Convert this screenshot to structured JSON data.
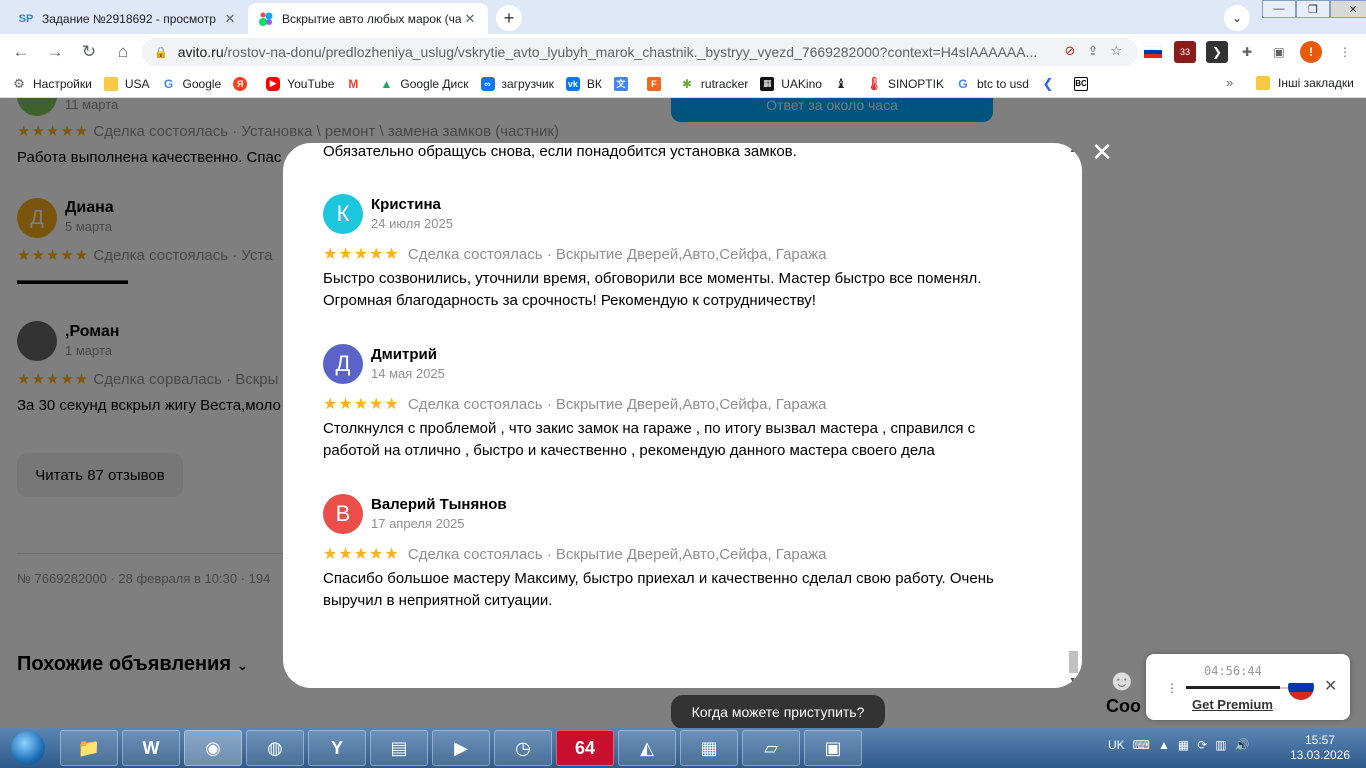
{
  "browser": {
    "tabs": [
      {
        "label": "Задание №2918692 - просмотр",
        "favicon": "SP"
      },
      {
        "label": "Вскрытие авто любых марок (ча",
        "favicon": "avito-dots"
      }
    ],
    "url_host": "avito.ru",
    "url_path": "/rostov-na-donu/predlozheniya_uslug/vskrytie_avto_lyubyh_marok_chastnik._bystryy_vyezd_7669282000?context=H4sIAAAAAA...",
    "extension_badge": "33",
    "bookmarks": [
      {
        "label": "Настройки",
        "icon": "gear-icon"
      },
      {
        "label": "USA",
        "icon": "folder-icon"
      },
      {
        "label": "Google",
        "icon": "google-icon"
      },
      {
        "label": "",
        "icon": "yandex-icon"
      },
      {
        "label": "YouTube",
        "icon": "youtube-icon"
      },
      {
        "label": "",
        "icon": "gmail-icon"
      },
      {
        "label": "Google Диск",
        "icon": "drive-icon"
      },
      {
        "label": "загрузчик",
        "icon": "loader-icon"
      },
      {
        "label": "ВК",
        "icon": "vk-icon"
      },
      {
        "label": "",
        "icon": "translate-icon"
      },
      {
        "label": "",
        "icon": "f-icon"
      },
      {
        "label": "rutracker",
        "icon": "rutracker-icon"
      },
      {
        "label": "UAKino",
        "icon": "uakino-icon"
      },
      {
        "label": "",
        "icon": "chess-icon"
      },
      {
        "label": "SINOPTIK",
        "icon": "thermometer-icon"
      },
      {
        "label": "btc to usd",
        "icon": "google-icon"
      },
      {
        "label": "",
        "icon": "arrow-icon"
      },
      {
        "label": "",
        "icon": "bc-icon"
      }
    ],
    "bookmarks_more": "»",
    "other_bookmarks": "Інші закладки"
  },
  "page_behind": {
    "top_date": "11 марта",
    "review1_meta": "Сделка состоялась · Установка \\ ремонт \\ замена замков (частник)",
    "review1_text": "Работа выполнена качественно. Спас",
    "review2_initial": "Д",
    "review2_name": "Диана",
    "review2_date": "5 марта",
    "review2_meta": "Сделка состоялась · Уста",
    "review2_text": "▬▬▬▬▬▬▬▬▬▬",
    "review3_name": ",Роман",
    "review3_date": "1 марта",
    "review3_meta": "Сделка сорвалась · Вскры",
    "review3_text": "За 30 секунд вскрыл жигу Веста,моло",
    "read_reviews_button": "Читать 87 отзывов",
    "listing_meta": "№ 7669282000 · 28 февраля в 10:30 · 194",
    "similar_heading": "Похожие объявления",
    "blue_button": "Ответ за около часа",
    "bottom_peek": "Соо"
  },
  "modal": {
    "top_text": "Обязательно обращусь снова, если понадобится установка замков.",
    "stars": "★★★★★",
    "reviews": [
      {
        "initial": "К",
        "avatar_color": "#1cc6dd",
        "name": "Кристина",
        "date": "24 июля 2025",
        "meta": "Сделка состоялась · Вскрытие Дверей,Авто,Сейфа, Гаража",
        "text_line1": "Быстро созвонились, уточнили время, обговорили все моменты. Мастер быстро все поменял.",
        "text_line2": "Огромная благодарность за срочность! Рекомендую к сотрудничеству!"
      },
      {
        "initial": "Д",
        "avatar_color": "#5a63c8",
        "name": "Дмитрий",
        "date": "14 мая 2025",
        "meta": "Сделка состоялась · Вскрытие Дверей,Авто,Сейфа, Гаража",
        "text_line1": "Столкнулся с проблемой , что закис замок на гараже , по итогу вызвал мастера , справился с",
        "text_line2": "работой на отлично , быстро и качественно , рекомендую данного мастера своего дела"
      },
      {
        "initial": "В",
        "avatar_color": "#ec4e4a",
        "name": "Валерий Тынянов",
        "date": "17 апреля 2025",
        "meta": "Сделка состоялась · Вскрытие Дверей,Авто,Сейфа, Гаража",
        "text_line1": "Спасибо большое мастеру Максиму, быстро приехал и качественно сделал свою работу. Очень",
        "text_line2": "выручил в неприятной ситуации."
      }
    ]
  },
  "toast": "Когда можете приступить?",
  "player": {
    "time": "04:56:44",
    "link": "Get Premium",
    "progress_fraction": 0.9
  },
  "taskbar": {
    "lang": "UK",
    "time": "15:57",
    "date": "13.03.2026",
    "app_64": "64"
  }
}
